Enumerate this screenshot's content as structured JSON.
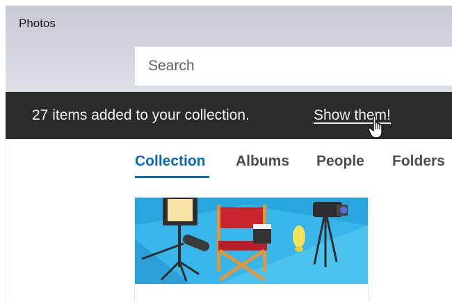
{
  "window": {
    "title": "Photos"
  },
  "search": {
    "placeholder": "Search",
    "value": ""
  },
  "notification": {
    "message": "27 items added to your collection.",
    "link_label": "Show them!"
  },
  "tabs": [
    {
      "label": "Collection",
      "active": true
    },
    {
      "label": "Albums",
      "active": false
    },
    {
      "label": "People",
      "active": false
    },
    {
      "label": "Folders",
      "active": false
    }
  ],
  "colors": {
    "accent": "#0a67b9",
    "notification_bg": "#2b2b2b",
    "tile_sky": "#2fb0e6"
  },
  "icons": [
    "hand-pointer-cursor-icon"
  ],
  "collection": {
    "tiles": [
      {
        "description_icon": "film-set-illustration"
      }
    ]
  }
}
